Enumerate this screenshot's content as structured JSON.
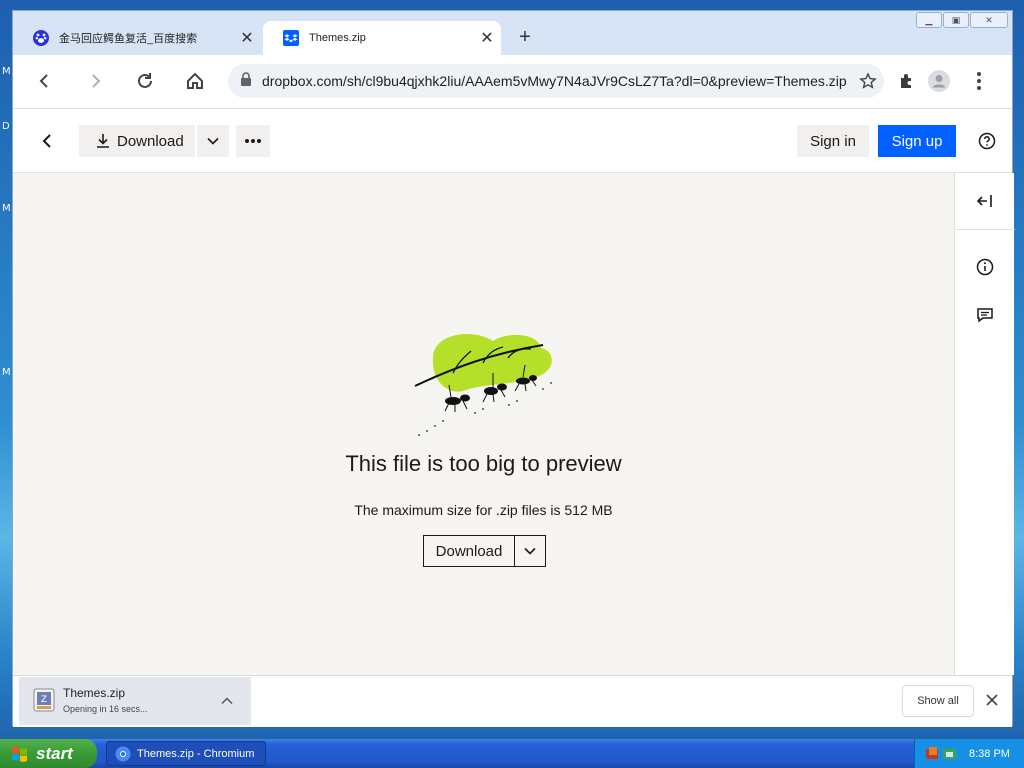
{
  "desktop": {
    "edge_letters": [
      "M",
      "D",
      "M",
      "M"
    ]
  },
  "browser": {
    "window_controls": [
      "minimize",
      "maximize",
      "close"
    ],
    "tabs": [
      {
        "title": "金马回应鳄鱼复活_百度搜索",
        "icon": "baidu-paw-icon",
        "active": false
      },
      {
        "title": "Themes.zip",
        "icon": "dropbox-icon",
        "active": true
      }
    ],
    "omnibox": {
      "url": "dropbox.com/sh/cl9bu4qjxhk2liu/AAAem5vMwy7N4aJVr9CsLZ7Ta?dl=0&preview=Themes.zip"
    }
  },
  "page": {
    "toolbar": {
      "download_label": "Download",
      "sign_in_label": "Sign in",
      "sign_up_label": "Sign up"
    },
    "preview": {
      "title": "This file is too big to preview",
      "subtitle": "The maximum size for .zip files is 512 MB",
      "download_label": "Download"
    },
    "colors": {
      "accent": "#0061fe",
      "leaf": "#b5e02a",
      "preview_bg": "#f7f5f2"
    }
  },
  "download_shelf": {
    "file_name": "Themes.zip",
    "status": "Opening in 16 secs...",
    "show_all_label": "Show all"
  },
  "taskbar": {
    "start_label": "start",
    "task_label": "Themes.zip - Chromium",
    "clock": "8:38 PM"
  }
}
